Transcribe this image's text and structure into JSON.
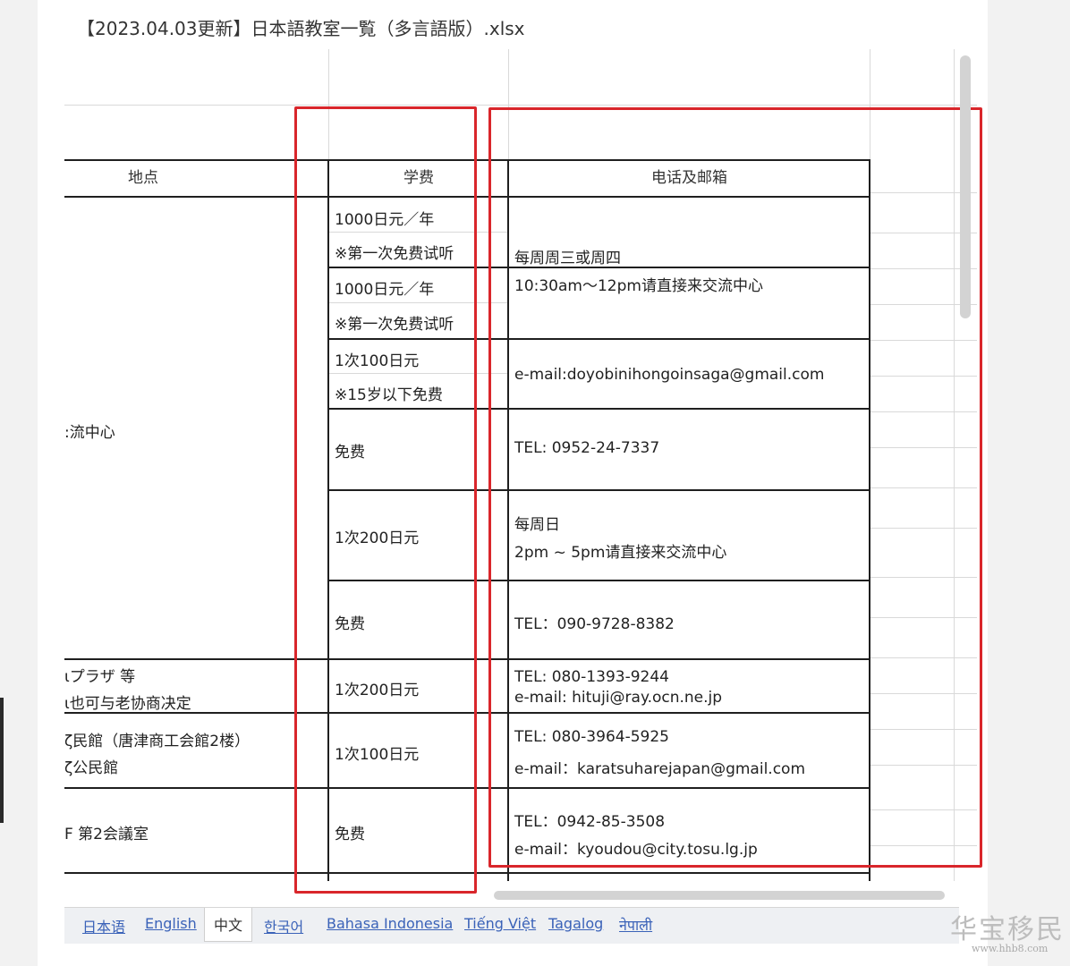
{
  "file_title": "【2023.04.03更新】日本語教室一覧（多言語版）.xlsx",
  "table": {
    "headers": {
      "location": "地点",
      "fee": "学费",
      "contact": "电话及邮箱"
    },
    "location_cells": [
      ":流中心",
      "ιプラザ 等",
      "ι也可与老协商决定",
      "ζ民館（唐津商工会館2楼）",
      "ζ公民館",
      "F 第2会議室"
    ],
    "fee_cells": [
      "1000日元／年",
      "※第一次免费试听",
      "1000日元／年",
      "※第一次免费试听",
      "1次100日元",
      "※15岁以下免费",
      "免费",
      "1次200日元",
      "免费",
      "1次200日元",
      "1次100日元",
      "免费"
    ],
    "contact_cells": [
      "每周周三或周四",
      "10:30am～12pm请直接来交流中心",
      "e-mail:doyobinihongoinsaga@gmail.com",
      "TEL: 0952-24-7337",
      "每周日",
      "2pm ~ 5pm请直接来交流中心",
      "TEL：090-9728-8382",
      "TEL: 080-1393-9244",
      "e-mail: hituji@ray.ocn.ne.jp",
      "TEL: 080-3964-5925",
      "e-mail：karatsuharejapan@gmail.com",
      "TEL：0942-85-3508",
      "e-mail：kyoudou@city.tosu.lg.jp"
    ]
  },
  "tabs": [
    "日本语",
    "English",
    "中文",
    "한국어",
    "Bahasa Indonesia",
    "Tiếng Việt",
    "Tagalog",
    "नेपाली"
  ],
  "active_tab": "中文",
  "watermark": {
    "text": "华宝移民",
    "url": "www.hhb8.com"
  },
  "colors": {
    "highlight_box": "#d9262b",
    "tab_link": "#3a62b8"
  }
}
